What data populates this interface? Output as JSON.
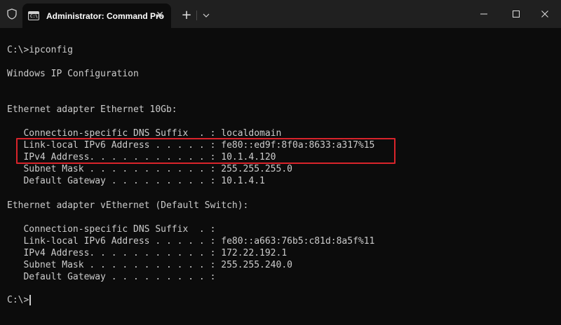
{
  "window": {
    "tab_title": "Administrator: Command Pro",
    "tab_icon_glyph": "C:\\",
    "icons": [
      "shield-icon",
      "terminal-icon",
      "close-icon",
      "plus-icon",
      "chevron-down-icon",
      "minimize-icon",
      "maximize-icon",
      "close-window-icon"
    ]
  },
  "colors": {
    "background": "#0c0c0c",
    "titlebar": "#202020",
    "text": "#cccccc",
    "highlight_border": "#d9242b"
  },
  "terminal": {
    "lines": [
      "C:\\>ipconfig",
      "Windows IP Configuration",
      "Ethernet adapter Ethernet 10Gb:",
      "   Connection-specific DNS Suffix  . : localdomain",
      "   Link-local IPv6 Address . . . . . : fe80::ed9f:8f0a:8633:a317%15",
      "   IPv4 Address. . . . . . . . . . . : 10.1.4.120",
      "   Subnet Mask . . . . . . . . . . . : 255.255.255.0",
      "   Default Gateway . . . . . . . . . : 10.1.4.1",
      "Ethernet adapter vEthernet (Default Switch):",
      "   Connection-specific DNS Suffix  . :",
      "   Link-local IPv6 Address . . . . . : fe80::a663:76b5:c81d:8a5f%11",
      "   IPv4 Address. . . . . . . . . . . : 172.22.192.1",
      "   Subnet Mask . . . . . . . . . . . : 255.255.240.0",
      "   Default Gateway . . . . . . . . . :",
      "C:\\>"
    ]
  }
}
